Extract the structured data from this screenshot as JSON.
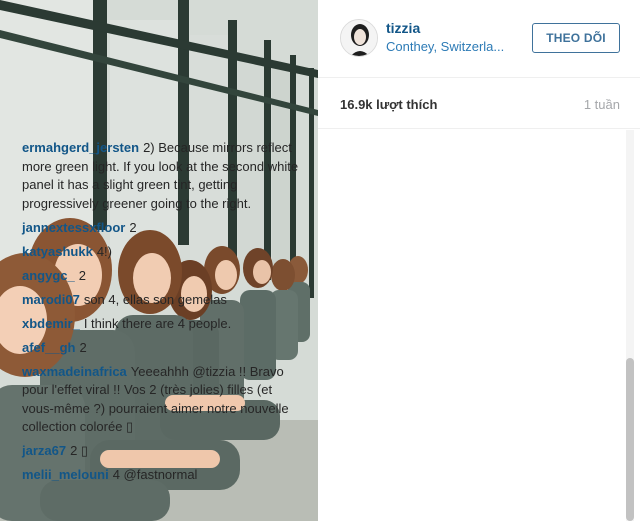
{
  "post": {
    "username": "tizzia",
    "location": "Conthey, Switzerla...",
    "follow_label": "THEO DÕI",
    "likes": "16.9k lượt thích",
    "time_ago": "1 tuần"
  },
  "comments": [
    {
      "user": "ermahgerd_jersten",
      "text": "2) Because mirrors reflect more green light. If you look at the second white panel it has a slight green tint, getting progressively greener going to the right."
    },
    {
      "user": "jannextessxfloor",
      "text": "2"
    },
    {
      "user": "katyashukk",
      "text": "4!)"
    },
    {
      "user": "angygc_",
      "text": "2"
    },
    {
      "user": "marodi07",
      "text": "son 4, ellas son gemelas"
    },
    {
      "user": "xbdemir_",
      "text": "I think there are 4 people."
    },
    {
      "user": "afef__gh",
      "text": "2"
    },
    {
      "user": "waxmadeinafrica",
      "text": "Yeeeahhh @tizzia !! Bravo pour l'effet viral !! Vos 2 (très jolies) filles (et vous-même ?) pourraient aimer notre nouvelle collection colorée ▯"
    },
    {
      "user": "jarza67",
      "text": "2 ▯"
    },
    {
      "user": "melii_melouni",
      "text": "4 @fastnormal"
    }
  ],
  "icons": {
    "avatar": "woman-portrait-avatar"
  },
  "colors": {
    "username": "#125688",
    "location": "#2d7bb6",
    "follow_border": "#3f729b"
  }
}
